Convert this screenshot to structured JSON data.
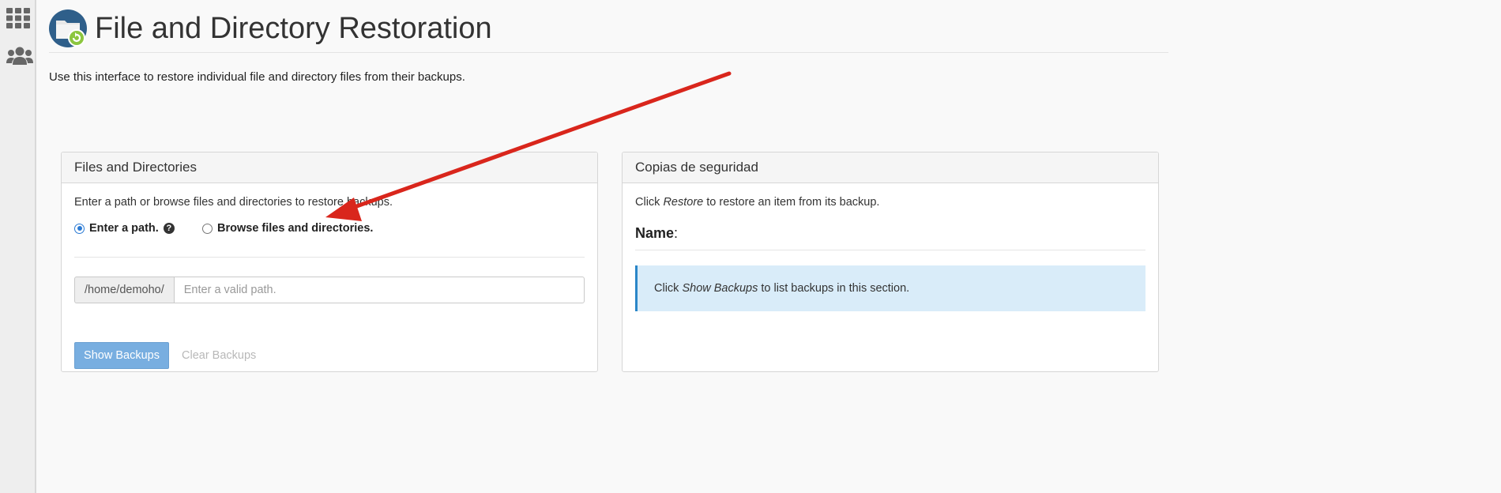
{
  "page": {
    "title": "File and Directory Restoration",
    "description": "Use this interface to restore individual file and directory files from their backups."
  },
  "files_panel": {
    "heading": "Files and Directories",
    "instructions": "Enter a path or browse files and directories to restore backups.",
    "radio_path": {
      "label": "Enter a path.",
      "checked": true
    },
    "radio_browse": {
      "label": "Browse files and directories.",
      "checked": false
    },
    "help_icon": "question-circle-icon",
    "path_prefix": "/home/demoho/",
    "path_input": {
      "value": "",
      "placeholder": "Enter a valid path."
    },
    "show_backups_label": "Show Backups",
    "clear_backups_label": "Clear Backups"
  },
  "backups_panel": {
    "heading": "Copias de seguridad",
    "instr_prefix": "Click ",
    "instr_em": "Restore",
    "instr_suffix": " to restore an item from its backup.",
    "name_label": "Name",
    "name_colon": ":",
    "info_prefix": "Click ",
    "info_em": "Show Backups",
    "info_suffix": " to list backups in this section."
  },
  "icons": {
    "rail": [
      "apps-grid-icon",
      "users-icon"
    ],
    "logo": "folder-restore-icon"
  },
  "colors": {
    "primary_button": "#78aee0",
    "info_bg": "#d9ecf9",
    "info_border": "#2a86c8",
    "radio_checked": "#2a7ad4",
    "arrow": "#d9261c"
  }
}
